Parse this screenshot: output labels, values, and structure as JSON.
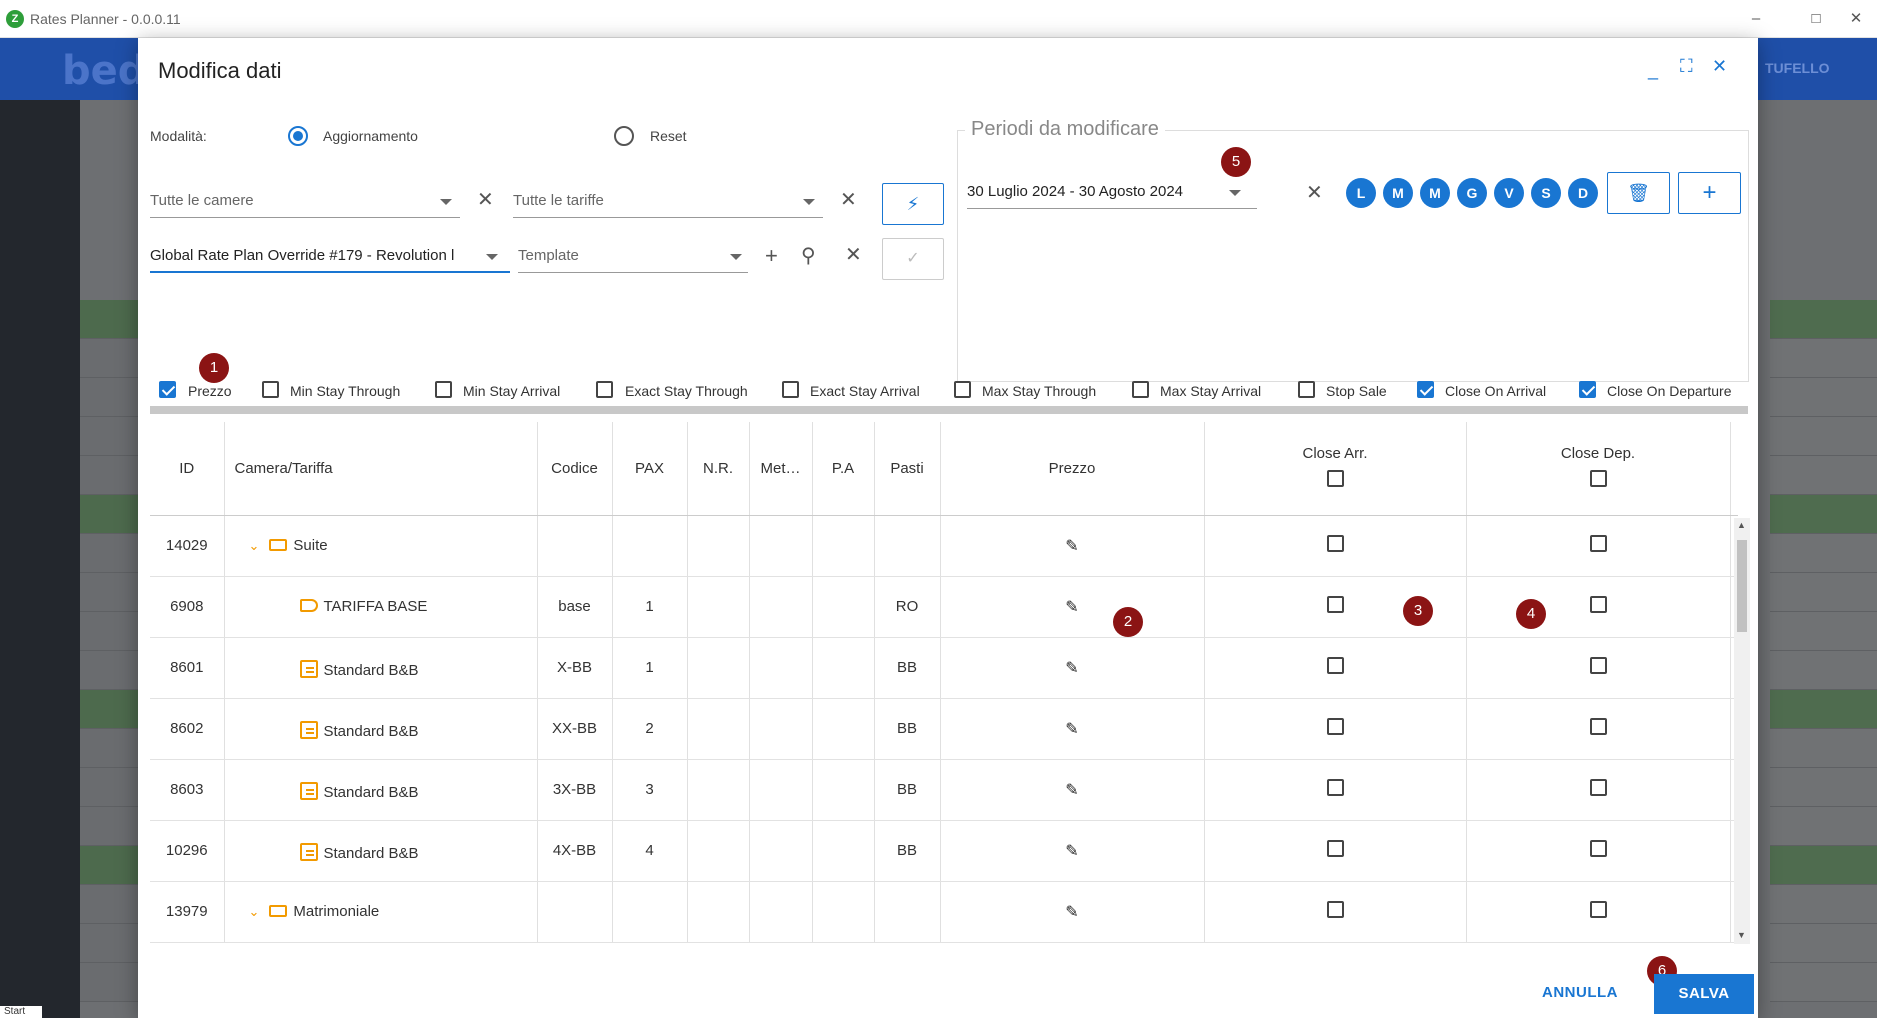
{
  "window": {
    "title": "Rates Planner - 0.0.0.11",
    "app_icon": "rates-planner-logo",
    "controls": [
      "minimize-icon",
      "maximize-icon",
      "close-icon"
    ]
  },
  "background_app": {
    "logo": "bedz",
    "user_label": "TUFELLO"
  },
  "start_label": "Start",
  "modal": {
    "title": "Modifica dati",
    "controls": [
      "minimize-icon",
      "fullscreen-icon",
      "close-icon"
    ],
    "mode": {
      "label": "Modalità:",
      "options": [
        {
          "label": "Aggiornamento",
          "selected": true
        },
        {
          "label": "Reset",
          "selected": false
        }
      ]
    },
    "filters": {
      "rooms_placeholder": "Tutte le camere",
      "rates_placeholder": "Tutte le tariffe",
      "rate_plan_value": "Global Rate Plan Override #179 - Revolution l",
      "template_placeholder": "Template"
    },
    "periods": {
      "title": "Periodi da modificare",
      "range_value": "30 Luglio 2024 - 30 Agosto 2024",
      "days": [
        "L",
        "M",
        "M",
        "G",
        "V",
        "S",
        "D"
      ]
    },
    "field_toggles": [
      {
        "label": "Prezzo",
        "checked": true
      },
      {
        "label": "Min Stay Through",
        "checked": false
      },
      {
        "label": "Min Stay Arrival",
        "checked": false
      },
      {
        "label": "Exact Stay Through",
        "checked": false
      },
      {
        "label": "Exact Stay Arrival",
        "checked": false
      },
      {
        "label": "Max Stay Through",
        "checked": false
      },
      {
        "label": "Max Stay Arrival",
        "checked": false
      },
      {
        "label": "Stop Sale",
        "checked": false
      },
      {
        "label": "Close On Arrival",
        "checked": true
      },
      {
        "label": "Close On Departure",
        "checked": true
      }
    ],
    "table": {
      "columns": [
        "ID",
        "Camera/Tariffa",
        "Codice",
        "PAX",
        "N.R.",
        "Met…",
        "P.A",
        "Pasti",
        "Prezzo",
        "Close Arr.",
        "Close Dep."
      ],
      "rows": [
        {
          "id": "14029",
          "name": "Suite",
          "type": "room",
          "code": "",
          "pax": "",
          "meals": ""
        },
        {
          "id": "6908",
          "name": "TARIFFA BASE",
          "type": "base-rate",
          "code": "base",
          "pax": "1",
          "meals": "RO"
        },
        {
          "id": "8601",
          "name": "Standard B&B",
          "type": "rate",
          "code": "X-BB",
          "pax": "1",
          "meals": "BB"
        },
        {
          "id": "8602",
          "name": "Standard B&B",
          "type": "rate",
          "code": "XX-BB",
          "pax": "2",
          "meals": "BB"
        },
        {
          "id": "8603",
          "name": "Standard B&B",
          "type": "rate",
          "code": "3X-BB",
          "pax": "3",
          "meals": "BB"
        },
        {
          "id": "10296",
          "name": "Standard B&B",
          "type": "rate",
          "code": "4X-BB",
          "pax": "4",
          "meals": "BB"
        },
        {
          "id": "13979",
          "name": "Matrimoniale",
          "type": "room",
          "code": "",
          "pax": "",
          "meals": ""
        }
      ]
    },
    "annotations": [
      "1",
      "2",
      "3",
      "4",
      "5",
      "6"
    ],
    "actions": {
      "cancel_label": "ANNULLA",
      "save_label": "SALVA"
    }
  }
}
